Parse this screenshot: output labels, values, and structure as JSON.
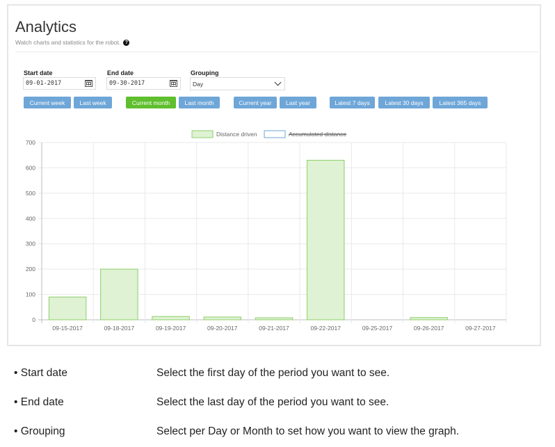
{
  "header": {
    "title": "Analytics",
    "subtitle": "Watch charts and statistics for the robot.",
    "help_icon": "question-circle-icon"
  },
  "filters": {
    "start_date": {
      "label": "Start date",
      "value": "09-01-2017"
    },
    "end_date": {
      "label": "End date",
      "value": "09-30-2017"
    },
    "grouping": {
      "label": "Grouping",
      "value": "Day"
    }
  },
  "quick_buttons": [
    {
      "label": "Current week",
      "active": false
    },
    {
      "label": "Last week",
      "active": false
    },
    {
      "label": "Current month",
      "active": true
    },
    {
      "label": "Last month",
      "active": false
    },
    {
      "label": "Current year",
      "active": false
    },
    {
      "label": "Last year",
      "active": false
    },
    {
      "label": "Latest 7 days",
      "active": false
    },
    {
      "label": "Latest 30 days",
      "active": false
    },
    {
      "label": "Latest 365 days",
      "active": false
    }
  ],
  "colors": {
    "button": "#6ea6d8",
    "button_active": "#5fbf2e",
    "bar_fill": "#dff2d4",
    "bar_stroke": "#8dcf6a",
    "accumulated_stroke": "#6ea6d8"
  },
  "chart_data": {
    "type": "bar",
    "categories": [
      "09-15-2017",
      "09-18-2017",
      "09-19-2017",
      "09-20-2017",
      "09-21-2017",
      "09-22-2017",
      "09-25-2017",
      "09-26-2017",
      "09-27-2017"
    ],
    "series": [
      {
        "name": "Distance driven",
        "values": [
          90,
          200,
          13,
          11,
          8,
          630,
          0,
          9,
          0
        ],
        "hidden": false
      },
      {
        "name": "Accumulated distance",
        "values": [],
        "hidden": true
      }
    ],
    "yticks": [
      0,
      100,
      200,
      300,
      400,
      500,
      600,
      700
    ],
    "ylim": [
      0,
      700
    ],
    "grid": true,
    "legend_position": "top-center"
  },
  "help": [
    {
      "term": "• Start date",
      "desc": "Select the first day of the period you want to see."
    },
    {
      "term": "• End date",
      "desc": "Select the last day of the period you want to see."
    },
    {
      "term": "• Grouping",
      "desc": "Select per Day or Month to set how you want to view the graph."
    }
  ]
}
